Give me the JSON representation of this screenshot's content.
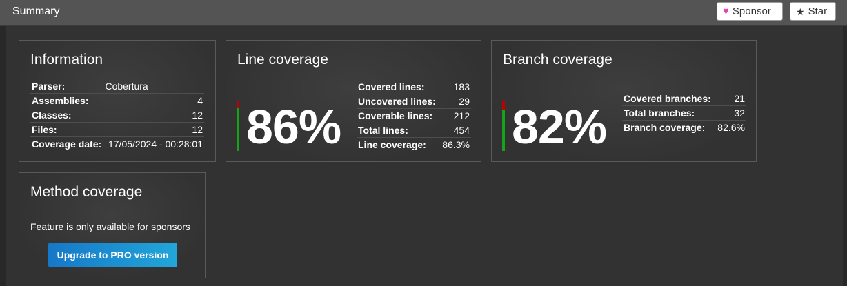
{
  "header": {
    "title": "Summary",
    "sponsor_label": "Sponsor",
    "star_label": "Star",
    "icons": {
      "sponsor": "heart-icon",
      "star": "star-icon"
    }
  },
  "colors": {
    "covered": "#16a31a",
    "uncovered": "#c00000",
    "sponsor_heart": "#e542b5"
  },
  "information": {
    "title": "Information",
    "rows": [
      {
        "label": "Parser:",
        "value": "Cobertura"
      },
      {
        "label": "Assemblies:",
        "value": "4"
      },
      {
        "label": "Classes:",
        "value": "12"
      },
      {
        "label": "Files:",
        "value": "12"
      },
      {
        "label": "Coverage date:",
        "value": "17/05/2024 - 00:28:01"
      }
    ]
  },
  "line_coverage": {
    "title": "Line coverage",
    "percent_text": "86%",
    "covered_fraction": 0.863,
    "rows": [
      {
        "label": "Covered lines:",
        "value": "183"
      },
      {
        "label": "Uncovered lines:",
        "value": "29"
      },
      {
        "label": "Coverable lines:",
        "value": "212"
      },
      {
        "label": "Total lines:",
        "value": "454"
      },
      {
        "label": "Line coverage:",
        "value": "86.3%"
      }
    ]
  },
  "branch_coverage": {
    "title": "Branch coverage",
    "percent_text": "82%",
    "covered_fraction": 0.826,
    "rows": [
      {
        "label": "Covered branches:",
        "value": "21"
      },
      {
        "label": "Total branches:",
        "value": "32"
      },
      {
        "label": "Branch coverage:",
        "value": "82.6%"
      }
    ]
  },
  "method_coverage": {
    "title": "Method coverage",
    "message": "Feature is only available for sponsors",
    "upgrade_label": "Upgrade to PRO version"
  }
}
